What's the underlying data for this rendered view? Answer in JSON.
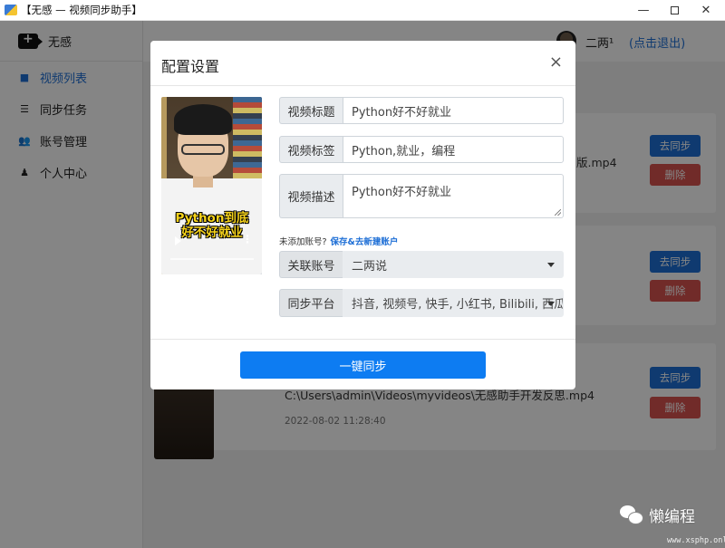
{
  "window": {
    "title": "【无感 — 视频同步助手】",
    "min": "—",
    "close": "✕"
  },
  "sidebar": {
    "brand": "无感",
    "items": [
      {
        "label": "视频列表",
        "icon": "video-camera-icon",
        "glyph": "■",
        "active": true
      },
      {
        "label": "同步任务",
        "icon": "server-icon",
        "glyph": "☰",
        "active": false
      },
      {
        "label": "账号管理",
        "icon": "users-icon",
        "glyph": "👥",
        "active": false
      },
      {
        "label": "个人中心",
        "icon": "user-icon",
        "glyph": "♟",
        "active": false
      }
    ]
  },
  "header": {
    "username": "二两¹",
    "logout": "(点击退出)"
  },
  "videos": [
    {
      "path": "版.mp4",
      "date": "",
      "sync_label": "去同步",
      "delete_label": "删除"
    },
    {
      "path": "",
      "date": "",
      "sync_label": "去同步",
      "delete_label": "删除"
    },
    {
      "path": "C:\\Users\\admin\\Videos\\myvideos\\无感助手开发反思.mp4",
      "date": "2022-08-02 11:28:40",
      "sync_label": "去同步",
      "delete_label": "删除"
    }
  ],
  "modal": {
    "title": "配置设置",
    "close": "×",
    "preview_caption_line1": "Python到底",
    "preview_caption_line2": "好不好就业",
    "fields": {
      "title_label": "视频标题",
      "title_value": "Python好不好就业",
      "tags_label": "视频标签",
      "tags_value": "Python,就业，编程",
      "desc_label": "视频描述",
      "desc_value": "Python好不好就业",
      "account_label": "关联账号",
      "account_value": "二两说",
      "platform_label": "同步平台",
      "platform_value": "抖音, 视频号, 快手, 小红书, Bilibili, 西瓜"
    },
    "note": "未添加账号?",
    "note_link": "保存&去新建账户",
    "submit": "一键同步"
  },
  "watermark": {
    "text": "懒编程",
    "url": "www.xsphp.online"
  },
  "colors": {
    "primary": "#0d7cf2",
    "link": "#1e6fd6",
    "danger": "#d9534f"
  }
}
